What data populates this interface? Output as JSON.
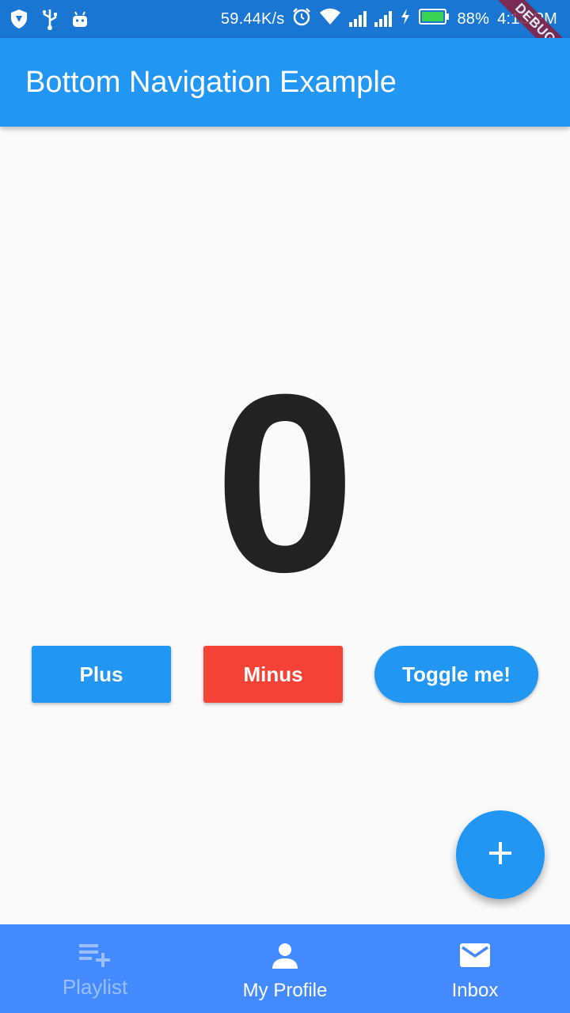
{
  "status_bar": {
    "net_speed": "59.44K/s",
    "battery": "88%",
    "time": "4:13 PM",
    "icons": [
      "shield-icon",
      "usb-icon",
      "android-icon",
      "alarm-icon",
      "wifi-icon",
      "signal-icon",
      "signal-icon",
      "charging-icon",
      "battery-icon"
    ]
  },
  "debug_banner": "DEBUG",
  "app_bar": {
    "title": "Bottom Navigation Example"
  },
  "counter": {
    "value": "0"
  },
  "buttons": {
    "plus": "Plus",
    "minus": "Minus",
    "toggle": "Toggle me!"
  },
  "fab": {
    "icon": "add-icon"
  },
  "bottom_nav": {
    "items": [
      {
        "label": "Playlist",
        "icon": "playlist-add-icon",
        "state": "inactive"
      },
      {
        "label": "My Profile",
        "icon": "person-icon",
        "state": "active"
      },
      {
        "label": "Inbox",
        "icon": "mail-icon",
        "state": "active"
      }
    ]
  },
  "colors": {
    "primary": "#2196f3",
    "status_bar": "#1976d2",
    "minus": "#f44336",
    "bottom_nav": "#448aff"
  }
}
